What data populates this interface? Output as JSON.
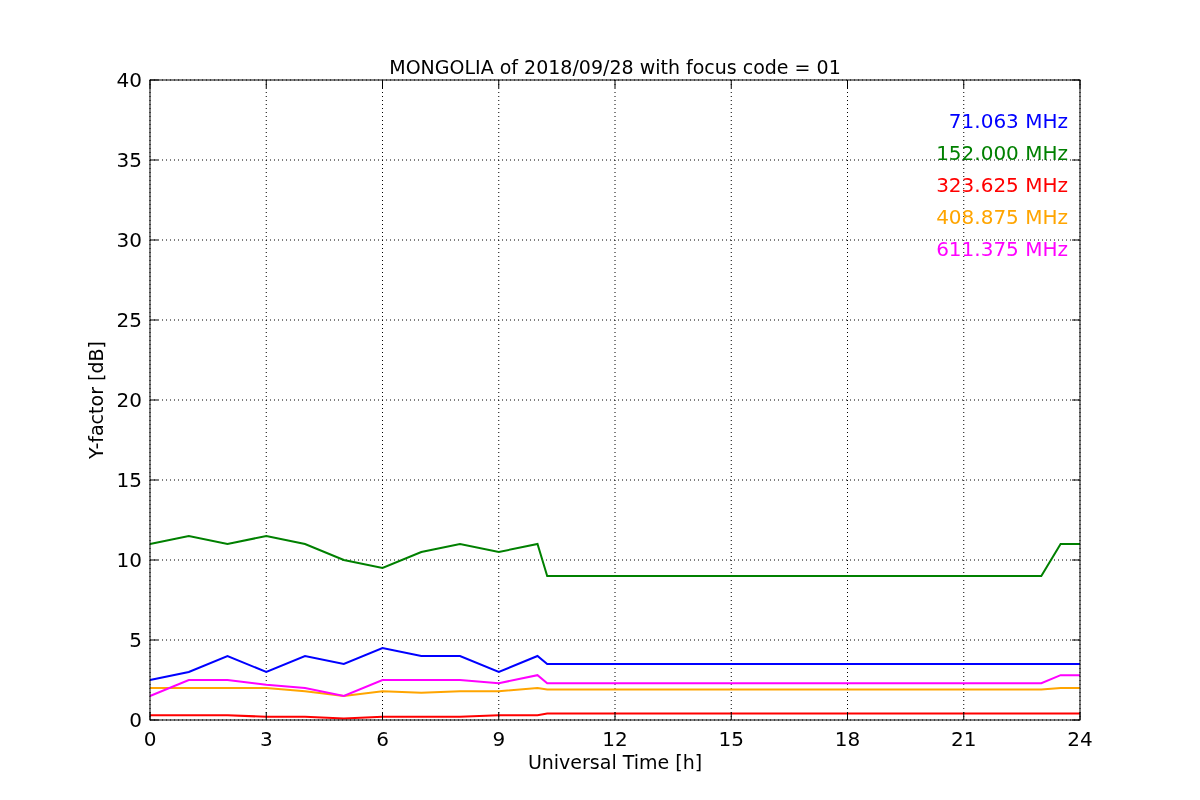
{
  "chart": {
    "chart_data": {
      "type": "line",
      "title": "MONGOLIA of 2018/09/28 with focus code = 01",
      "xlabel": "Universal Time [h]",
      "ylabel": "Y-factor [dB]",
      "x": [
        0,
        1,
        2,
        3,
        4,
        5,
        6,
        7,
        8,
        9,
        10,
        10.25,
        23,
        23.5,
        24
      ],
      "series": [
        {
          "name": "71.063 MHz",
          "color": "#0000ff",
          "values": [
            2.5,
            3,
            4,
            3,
            4,
            3.5,
            4.5,
            4,
            4,
            3,
            4,
            3.5,
            3.5,
            3.5,
            3.5
          ]
        },
        {
          "name": "152.000 MHz",
          "color": "#008000",
          "values": [
            11,
            11.5,
            11,
            11.5,
            11,
            10,
            9.5,
            10.5,
            11,
            10.5,
            11,
            9,
            9,
            11,
            11
          ]
        },
        {
          "name": "323.625 MHz",
          "color": "#ff0000",
          "values": [
            0.3,
            0.3,
            0.3,
            0.2,
            0.2,
            0.1,
            0.2,
            0.2,
            0.2,
            0.3,
            0.3,
            0.4,
            0.4,
            0.4,
            0.4
          ]
        },
        {
          "name": "408.875 MHz",
          "color": "#ffa500",
          "values": [
            2,
            2,
            2,
            2,
            1.8,
            1.5,
            1.8,
            1.7,
            1.8,
            1.8,
            2,
            1.9,
            1.9,
            2,
            2
          ]
        },
        {
          "name": "611.375 MHz",
          "color": "#ff00ff",
          "values": [
            1.5,
            2.5,
            2.5,
            2.2,
            2,
            1.5,
            2.5,
            2.5,
            2.5,
            2.3,
            2.8,
            2.3,
            2.3,
            2.8,
            2.8
          ]
        }
      ],
      "xlim": [
        0,
        24
      ],
      "ylim": [
        0,
        40
      ],
      "xticks": [
        0,
        3,
        6,
        9,
        12,
        15,
        18,
        21,
        24
      ],
      "yticks": [
        0,
        5,
        10,
        15,
        20,
        25,
        30,
        35,
        40
      ],
      "grid": true
    }
  }
}
